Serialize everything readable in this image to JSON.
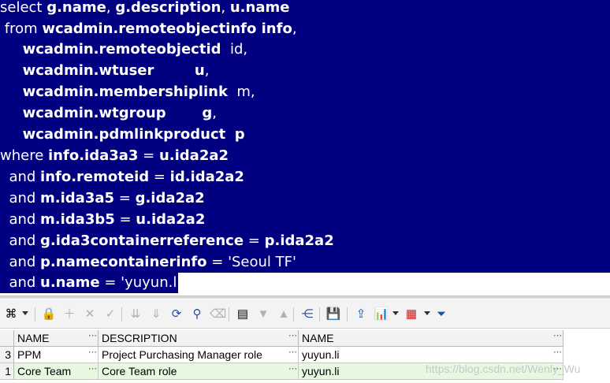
{
  "editor": {
    "lines": [
      [
        {
          "t": "select ",
          "c": "kw"
        },
        {
          "t": "g.name",
          "c": "id"
        },
        {
          "t": ", ",
          "c": "kw"
        },
        {
          "t": "g.description",
          "c": "id"
        },
        {
          "t": ", ",
          "c": "kw"
        },
        {
          "t": "u.name",
          "c": "id"
        }
      ],
      [
        {
          "t": " from ",
          "c": "kw"
        },
        {
          "t": "wcadmin.remoteobjectinfo info",
          "c": "id"
        },
        {
          "t": ",",
          "c": "kw"
        }
      ],
      [
        {
          "t": "     ",
          "c": "kw"
        },
        {
          "t": "wcadmin.remoteobjectid",
          "c": "id"
        },
        {
          "t": "  id,",
          "c": "al"
        }
      ],
      [
        {
          "t": "     ",
          "c": "kw"
        },
        {
          "t": "wcadmin.wtuser",
          "c": "id"
        },
        {
          "t": "         ",
          "c": "kw"
        },
        {
          "t": "u",
          "c": "id"
        },
        {
          "t": ",",
          "c": "kw"
        }
      ],
      [
        {
          "t": "     ",
          "c": "kw"
        },
        {
          "t": "wcadmin.membershiplink",
          "c": "id"
        },
        {
          "t": "  m,",
          "c": "al"
        }
      ],
      [
        {
          "t": "     ",
          "c": "kw"
        },
        {
          "t": "wcadmin.wtgroup",
          "c": "id"
        },
        {
          "t": "        ",
          "c": "kw"
        },
        {
          "t": "g",
          "c": "id"
        },
        {
          "t": ",",
          "c": "kw"
        }
      ],
      [
        {
          "t": "     ",
          "c": "kw"
        },
        {
          "t": "wcadmin.pdmlinkproduct",
          "c": "id"
        },
        {
          "t": "  ",
          "c": "kw"
        },
        {
          "t": "p",
          "c": "id"
        }
      ],
      [
        {
          "t": "where ",
          "c": "kw"
        },
        {
          "t": "info.ida3a3",
          "c": "id"
        },
        {
          "t": " = ",
          "c": "kw"
        },
        {
          "t": "u.ida2a2",
          "c": "id"
        }
      ],
      [
        {
          "t": "  and ",
          "c": "kw"
        },
        {
          "t": "info.remoteid",
          "c": "id"
        },
        {
          "t": " = ",
          "c": "kw"
        },
        {
          "t": "id.ida2a2",
          "c": "id"
        }
      ],
      [
        {
          "t": "  and ",
          "c": "kw"
        },
        {
          "t": "m.ida3a5",
          "c": "id"
        },
        {
          "t": " = ",
          "c": "kw"
        },
        {
          "t": "g.ida2a2",
          "c": "id"
        }
      ],
      [
        {
          "t": "  and ",
          "c": "kw"
        },
        {
          "t": "m.ida3b5",
          "c": "id"
        },
        {
          "t": " = ",
          "c": "kw"
        },
        {
          "t": "u.ida2a2",
          "c": "id"
        }
      ],
      [
        {
          "t": "  and ",
          "c": "kw"
        },
        {
          "t": "g.ida3containerreference",
          "c": "id"
        },
        {
          "t": " = ",
          "c": "kw"
        },
        {
          "t": "p.ida2a2",
          "c": "id"
        }
      ],
      [
        {
          "t": "  and ",
          "c": "kw"
        },
        {
          "t": "p.namecontainerinfo",
          "c": "id"
        },
        {
          "t": " = ",
          "c": "kw"
        },
        {
          "t": "'Seoul TF'",
          "c": "lit"
        }
      ],
      [
        {
          "t": "  and ",
          "c": "kw"
        },
        {
          "t": "u.name",
          "c": "id"
        },
        {
          "t": " = ",
          "c": "kw"
        },
        {
          "t": "'yuyun.li';",
          "c": "lit"
        }
      ]
    ],
    "selection_color": "#000080",
    "text_color": "#ffffff"
  },
  "toolbar": {
    "icons": [
      {
        "name": "grid-options-icon",
        "glyph": "⌘",
        "enabled": true
      },
      {
        "name": "lock-icon",
        "glyph": "🔒",
        "enabled": true
      },
      {
        "name": "insert-record-icon",
        "glyph": "＋",
        "enabled": false
      },
      {
        "name": "delete-record-icon",
        "glyph": "✕",
        "enabled": false
      },
      {
        "name": "post-changes-icon",
        "glyph": "✓",
        "enabled": false
      },
      {
        "name": "fetch-next-page-icon",
        "glyph": "⇊",
        "enabled": false
      },
      {
        "name": "fetch-last-page-icon",
        "glyph": "⇓",
        "enabled": false
      },
      {
        "name": "refresh-icon",
        "glyph": "⟳",
        "enabled": true
      },
      {
        "name": "find-icon",
        "glyph": "⚲",
        "enabled": true
      },
      {
        "name": "clear-icon",
        "glyph": "⌫",
        "enabled": false
      },
      {
        "name": "single-record-view-icon",
        "glyph": "▤",
        "enabled": true
      },
      {
        "name": "next-record-icon",
        "glyph": "▼",
        "enabled": false
      },
      {
        "name": "previous-record-icon",
        "glyph": "▲",
        "enabled": false
      },
      {
        "name": "query-by-example-icon",
        "glyph": "⋲",
        "enabled": true
      },
      {
        "name": "save-icon",
        "glyph": "💾",
        "enabled": true
      },
      {
        "name": "export-icon",
        "glyph": "⇪",
        "enabled": true
      },
      {
        "name": "chart-icon",
        "glyph": "📊",
        "enabled": true
      },
      {
        "name": "table-icon",
        "glyph": "▦",
        "enabled": true
      },
      {
        "name": "filter-icon",
        "glyph": "⏷",
        "enabled": true
      }
    ]
  },
  "grid": {
    "columns": [
      "NAME",
      "DESCRIPTION",
      "NAME"
    ],
    "rows": [
      {
        "num": "3",
        "cells": [
          "PPM",
          "Project Purchasing Manager role",
          "yuyun.li"
        ]
      },
      {
        "num": "1",
        "cells": [
          "Core Team",
          "Core Team role",
          "yuyun.li"
        ]
      }
    ],
    "row_colors": [
      "#ffffff",
      "#e6f9e0"
    ]
  },
  "watermark": "https://blog.csdn.net/Wenly_Wu"
}
